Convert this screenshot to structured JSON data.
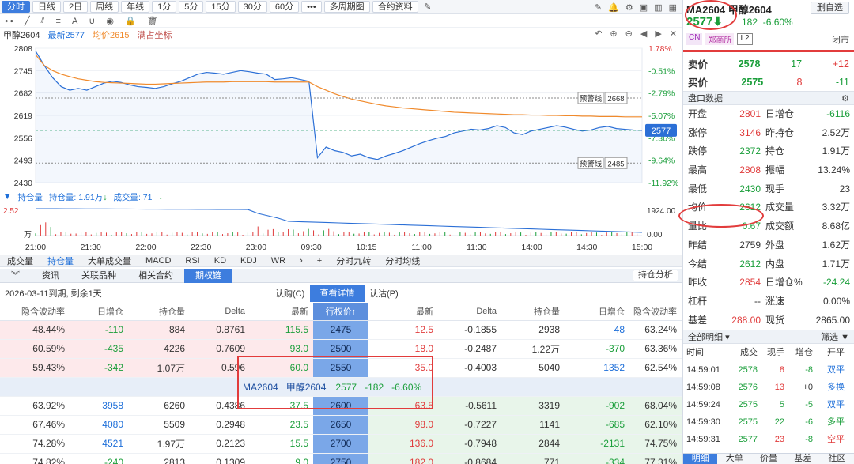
{
  "toolbar": {
    "tabs": [
      "分时",
      "日线",
      "2日",
      "周线",
      "年线",
      "1分",
      "5分",
      "15分",
      "30分",
      "60分",
      "多周期图",
      "合约资料"
    ],
    "active": "分时"
  },
  "legend": {
    "name": "甲醇2604",
    "latest_label": "最新2577",
    "avg_label": "均价2615",
    "coords_label": "满占坐标"
  },
  "chart_data": [
    {
      "type": "line",
      "title": "甲醇2604",
      "x_ticks": [
        "21:00",
        "21:30",
        "22:00",
        "22:30",
        "23:00",
        "09:30",
        "10:15",
        "11:00",
        "11:30",
        "14:00",
        "14:30",
        "15:00"
      ],
      "y_left_ticks": [
        2808,
        2745,
        2682,
        2619,
        2556,
        2493,
        2430
      ],
      "y_right_ticks": [
        "1.78%",
        "-0.51%",
        "-2.79%",
        "-5.07%",
        "-7.36%",
        "-9.64%",
        "-11.92%"
      ],
      "ylim": [
        2430,
        2808
      ],
      "series": [
        {
          "name": "最新",
          "color": "#2b6fd6",
          "values": [
            2800,
            2760,
            2725,
            2700,
            2690,
            2695,
            2690,
            2700,
            2710,
            2715,
            2712,
            2705,
            2700,
            2698,
            2695,
            2700,
            2708,
            2715,
            2725,
            2735,
            2740,
            2738,
            2735,
            2740,
            2745,
            2742,
            2738,
            2735,
            2720,
            2722,
            2725,
            2720,
            2715,
            2500,
            2530,
            2520,
            2515,
            2505,
            2510,
            2500,
            2495,
            2505,
            2512,
            2520,
            2530,
            2540,
            2548,
            2555,
            2560,
            2570,
            2575,
            2580,
            2578,
            2582,
            2590,
            2585,
            2570,
            2565,
            2575,
            2580,
            2585,
            2590,
            2586,
            2580,
            2575,
            2578,
            2585,
            2588,
            2582,
            2580,
            2578,
            2577
          ]
        },
        {
          "name": "均价",
          "color": "#f08a2c",
          "values": [
            2790,
            2760,
            2745,
            2735,
            2728,
            2722,
            2718,
            2714,
            2712,
            2711,
            2710,
            2709,
            2708,
            2707,
            2707,
            2708,
            2709,
            2710,
            2711,
            2712,
            2713,
            2713,
            2713,
            2714,
            2714,
            2714,
            2714,
            2714,
            2713,
            2713,
            2713,
            2713,
            2713,
            2700,
            2690,
            2680,
            2672,
            2665,
            2660,
            2655,
            2650,
            2646,
            2643,
            2640,
            2638,
            2636,
            2634,
            2632,
            2630,
            2628,
            2627,
            2626,
            2625,
            2624,
            2623,
            2622,
            2621,
            2621,
            2620,
            2620,
            2619,
            2619,
            2618,
            2618,
            2617,
            2617,
            2616,
            2616,
            2616,
            2615,
            2615,
            2615
          ]
        }
      ],
      "ref_lines": [
        {
          "label": "预警线",
          "value": 2668
        },
        {
          "label": "预警线",
          "value": 2485
        }
      ],
      "current_value": 2577
    }
  ],
  "volume": {
    "legend": "持仓量",
    "oi": "1.91万",
    "vol_label": "成交量",
    "vol": "71",
    "y_left": [
      "2.52",
      "万"
    ],
    "y_right": [
      "1924.00",
      "0.00"
    ]
  },
  "tabs2": [
    "成交量",
    "持仓量",
    "大单成交量",
    "MACD",
    "RSI",
    "KD",
    "KDJ",
    "WR",
    "分时九转",
    "分时均线"
  ],
  "tabs3": [
    "资讯",
    "关联品种",
    "相关合约",
    "期权链"
  ],
  "btn_analysis": "持仓分析",
  "opt_info": {
    "expiry": "2026-03-11到期, 剩余1天",
    "call": "认购(C)",
    "detail": "查看详情",
    "put": "认沽(P)"
  },
  "opt_headers": [
    "隐含波动率",
    "日增仓",
    "持仓量",
    "Delta",
    "最新",
    "行权价↑",
    "最新",
    "Delta",
    "持仓量",
    "日增仓",
    "隐含波动率"
  ],
  "opt_rows": [
    [
      "48.44%",
      "-110",
      "884",
      "0.8761",
      "115.5",
      "2475",
      "12.5",
      "-0.1855",
      "2938",
      "48",
      "63.24%"
    ],
    [
      "60.59%",
      "-435",
      "4226",
      "0.7609",
      "93.0",
      "2500",
      "18.0",
      "-0.2487",
      "1.22万",
      "-370",
      "63.36%"
    ],
    [
      "59.43%",
      "-342",
      "1.07万",
      "0.596",
      "60.0",
      "2550",
      "35.0",
      "-0.4003",
      "5040",
      "1352",
      "62.54%"
    ],
    [
      "63.92%",
      "3958",
      "6260",
      "0.4386",
      "37.5",
      "2600",
      "63.5",
      "-0.5611",
      "3319",
      "-902",
      "68.04%"
    ],
    [
      "67.46%",
      "4080",
      "5509",
      "0.2948",
      "23.5",
      "2650",
      "98.0",
      "-0.7227",
      "1141",
      "-685",
      "62.10%"
    ],
    [
      "74.28%",
      "4521",
      "1.97万",
      "0.2123",
      "15.5",
      "2700",
      "136.0",
      "-0.7948",
      "2844",
      "-2131",
      "74.75%"
    ],
    [
      "74.82%",
      "-240",
      "2813",
      "0.1309",
      "9.0",
      "2750",
      "182.0",
      "-0.8684",
      "771",
      "-334",
      "77.31%"
    ]
  ],
  "underlying_row": {
    "code": "MA2604",
    "name": "甲醇2604",
    "price": "2577",
    "chg": "-182",
    "pct": "-6.60%"
  },
  "right": {
    "code": "MA2604",
    "name": "甲醇2604",
    "btn": "删自选",
    "price": "2577",
    "chg": "182",
    "pct": "-6.60%",
    "tag_cn": "CN",
    "tag_ex": "郑商所",
    "tag_l2": "L2",
    "status": "闭市",
    "ask_label": "卖价",
    "ask": "2578",
    "ask_vol": "17",
    "ask_chg": "+12",
    "bid_label": "买价",
    "bid": "2575",
    "bid_vol": "8",
    "bid_chg": "-11",
    "panel_title": "盘口数据",
    "stats": [
      [
        "开盘",
        "2801",
        "日增仓",
        "-6116"
      ],
      [
        "涨停",
        "3146",
        "昨持仓",
        "2.52万"
      ],
      [
        "跌停",
        "2372",
        "持仓",
        "1.91万"
      ],
      [
        "最高",
        "2808",
        "振幅",
        "13.24%"
      ],
      [
        "最低",
        "2430",
        "现手",
        "23"
      ],
      [
        "均价",
        "2612",
        "成交量",
        "3.32万"
      ],
      [
        "量比",
        "0.67",
        "成交额",
        "8.68亿"
      ],
      [
        "昨结",
        "2759",
        "外盘",
        "1.62万"
      ],
      [
        "今结",
        "2612",
        "内盘",
        "1.71万"
      ],
      [
        "昨收",
        "2854",
        "日增仓%",
        "-24.24"
      ],
      [
        "杠杆",
        "--",
        "涨速",
        "0.00%"
      ],
      [
        "基差",
        "288.00",
        "现货",
        "2865.00"
      ]
    ],
    "detail_title": "全部明细",
    "filter": "筛选",
    "detail_headers": [
      "时间",
      "成交",
      "现手",
      "增仓",
      "开平"
    ],
    "details": [
      [
        "14:59:01",
        "2578",
        "8",
        "-8",
        "双平"
      ],
      [
        "14:59:08",
        "2576",
        "13",
        "+0",
        "多换"
      ],
      [
        "14:59:24",
        "2575",
        "5",
        "-5",
        "双平"
      ],
      [
        "14:59:30",
        "2575",
        "22",
        "-6",
        "多平"
      ],
      [
        "14:59:31",
        "2577",
        "23",
        "-8",
        "空平"
      ]
    ],
    "bottom_tabs": [
      "明细",
      "大单",
      "价量",
      "基差",
      "社区"
    ]
  }
}
